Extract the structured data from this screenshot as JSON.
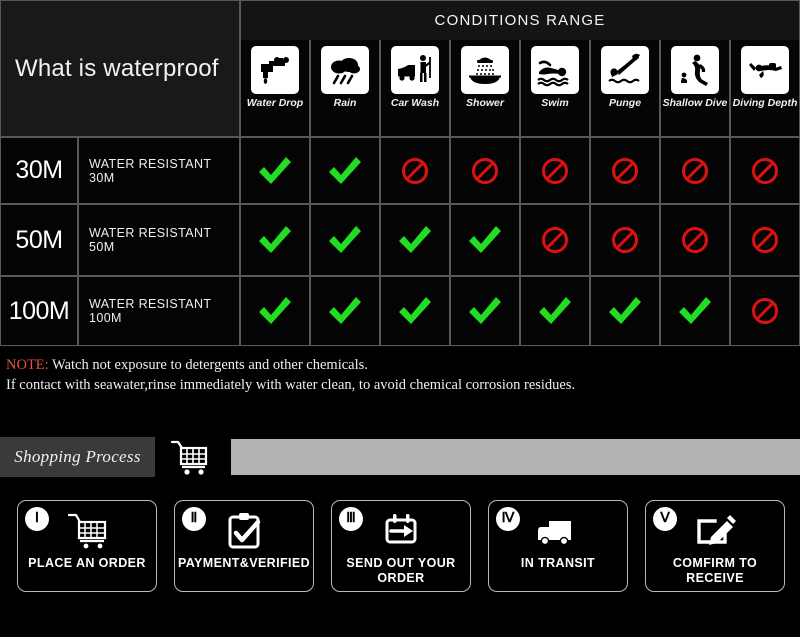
{
  "table": {
    "title": "What is waterproof",
    "conditions_header": "CONDITIONS RANGE",
    "conditions": [
      {
        "label": "Water Drop",
        "icon": "faucet-drop-icon"
      },
      {
        "label": "Rain",
        "icon": "rain-cloud-icon"
      },
      {
        "label": "Car Wash",
        "icon": "car-wash-icon"
      },
      {
        "label": "Shower",
        "icon": "shower-icon"
      },
      {
        "label": "Swim",
        "icon": "swim-icon"
      },
      {
        "label": "Punge",
        "icon": "plunge-dive-icon"
      },
      {
        "label": "Shallow Dive",
        "icon": "shallow-dive-icon"
      },
      {
        "label": "Diving Depth",
        "icon": "scuba-diver-icon"
      }
    ],
    "rows": [
      {
        "depth": "30M",
        "description": "WATER RESISTANT  30M",
        "marks": [
          "check",
          "check",
          "no",
          "no",
          "no",
          "no",
          "no",
          "no"
        ]
      },
      {
        "depth": "50M",
        "description": "WATER RESISTANT 50M",
        "marks": [
          "check",
          "check",
          "check",
          "check",
          "no",
          "no",
          "no",
          "no"
        ]
      },
      {
        "depth": "100M",
        "description": "WATER RESISTANT  100M",
        "marks": [
          "check",
          "check",
          "check",
          "check",
          "check",
          "check",
          "check",
          "no"
        ]
      }
    ]
  },
  "note": {
    "keyword": "NOTE:",
    "line1": " Watch not exposure to detergents and other chemicals.",
    "line2": "If contact with seawater,rinse immediately with water clean, to avoid chemical corrosion residues."
  },
  "shopping_process": {
    "label": "Shopping Process",
    "cart_icon": "shopping-cart-icon"
  },
  "steps": [
    {
      "numeral": "Ⅰ",
      "label": "PLACE AN ORDER",
      "icon": "shopping-cart-icon"
    },
    {
      "numeral": "Ⅱ",
      "label": "PAYMENT&VERIFIED",
      "icon": "clipboard-check-icon"
    },
    {
      "numeral": "Ⅲ",
      "label": "SEND OUT\nYOUR ORDER",
      "icon": "package-arrow-icon"
    },
    {
      "numeral": "Ⅳ",
      "label": "IN TRANSIT",
      "icon": "delivery-truck-icon"
    },
    {
      "numeral": "Ⅴ",
      "label": "COMFIRM\nTO RECEIVE",
      "icon": "edit-pencil-icon"
    }
  ],
  "colors": {
    "check_green": "#22dd22",
    "deny_red": "#dd1111",
    "note_keyword": "#e0533a",
    "banner_gray": "#b3b3b5",
    "label_gray": "#3a3a3a"
  }
}
